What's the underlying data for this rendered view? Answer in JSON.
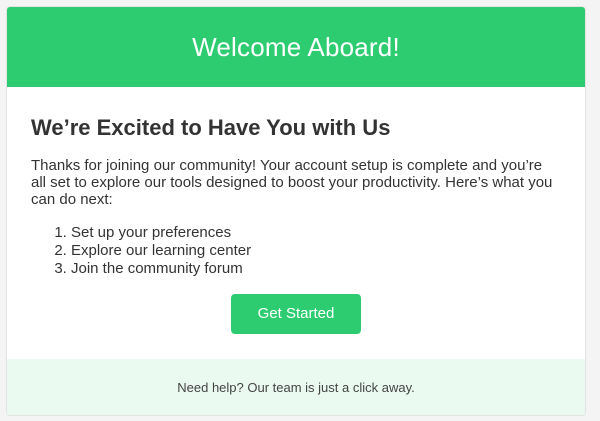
{
  "header": {
    "title": "Welcome Aboard!"
  },
  "content": {
    "heading": "We’re Excited to Have You with Us",
    "paragraph": "Thanks for joining our community! Your account setup is complete and you’re all set to explore our tools designed to boost your productivity. Here’s what you can do next:",
    "steps": [
      "Set up your preferences",
      "Explore our learning center",
      "Join the community forum"
    ],
    "button_label": "Get Started"
  },
  "footer": {
    "text": "Need help? Our team is just a click away."
  },
  "colors": {
    "accent": "#2ecc71",
    "footer_bg": "#eafaf1"
  }
}
